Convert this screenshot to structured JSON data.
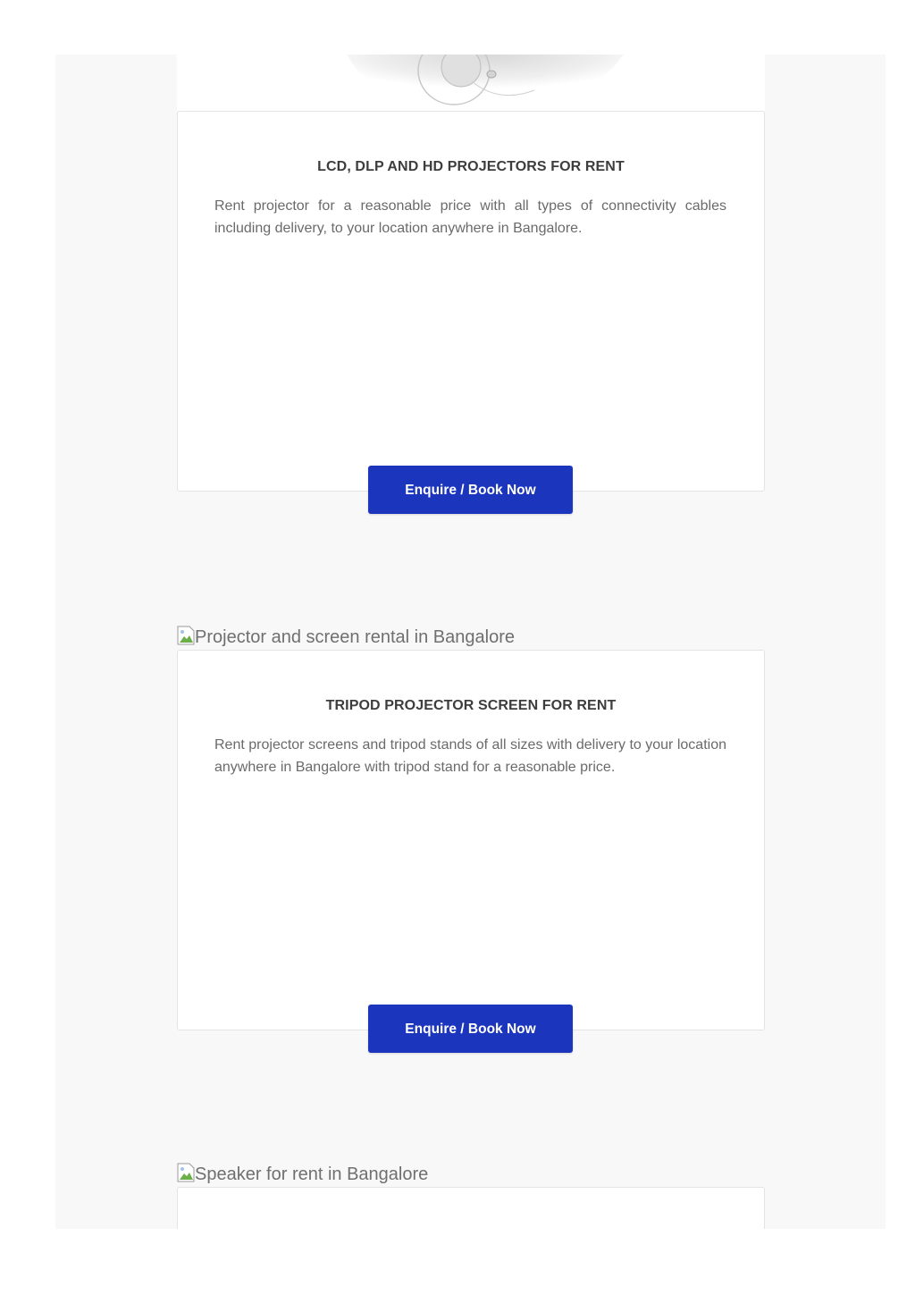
{
  "cards": [
    {
      "title": "LCD, DLP AND HD PROJECTORS FOR RENT",
      "text": "Rent projector for a reasonable price with all types of connectivity cables including delivery, to your location anywhere in Bangalore.",
      "button_label": "Enquire / Book Now"
    },
    {
      "image_alt": "Projector and screen rental in Bangalore",
      "title": "TRIPOD PROJECTOR SCREEN FOR RENT",
      "text": "Rent projector screens and tripod stands of all sizes with delivery to your location anywhere in Bangalore with tripod stand for a reasonable price.",
      "button_label": "Enquire / Book Now"
    },
    {
      "image_alt": "Speaker for rent in Bangalore"
    }
  ],
  "colors": {
    "button": "#1c35bd",
    "page_background": "#f8f8f8",
    "card_border": "#e4e4e4"
  }
}
